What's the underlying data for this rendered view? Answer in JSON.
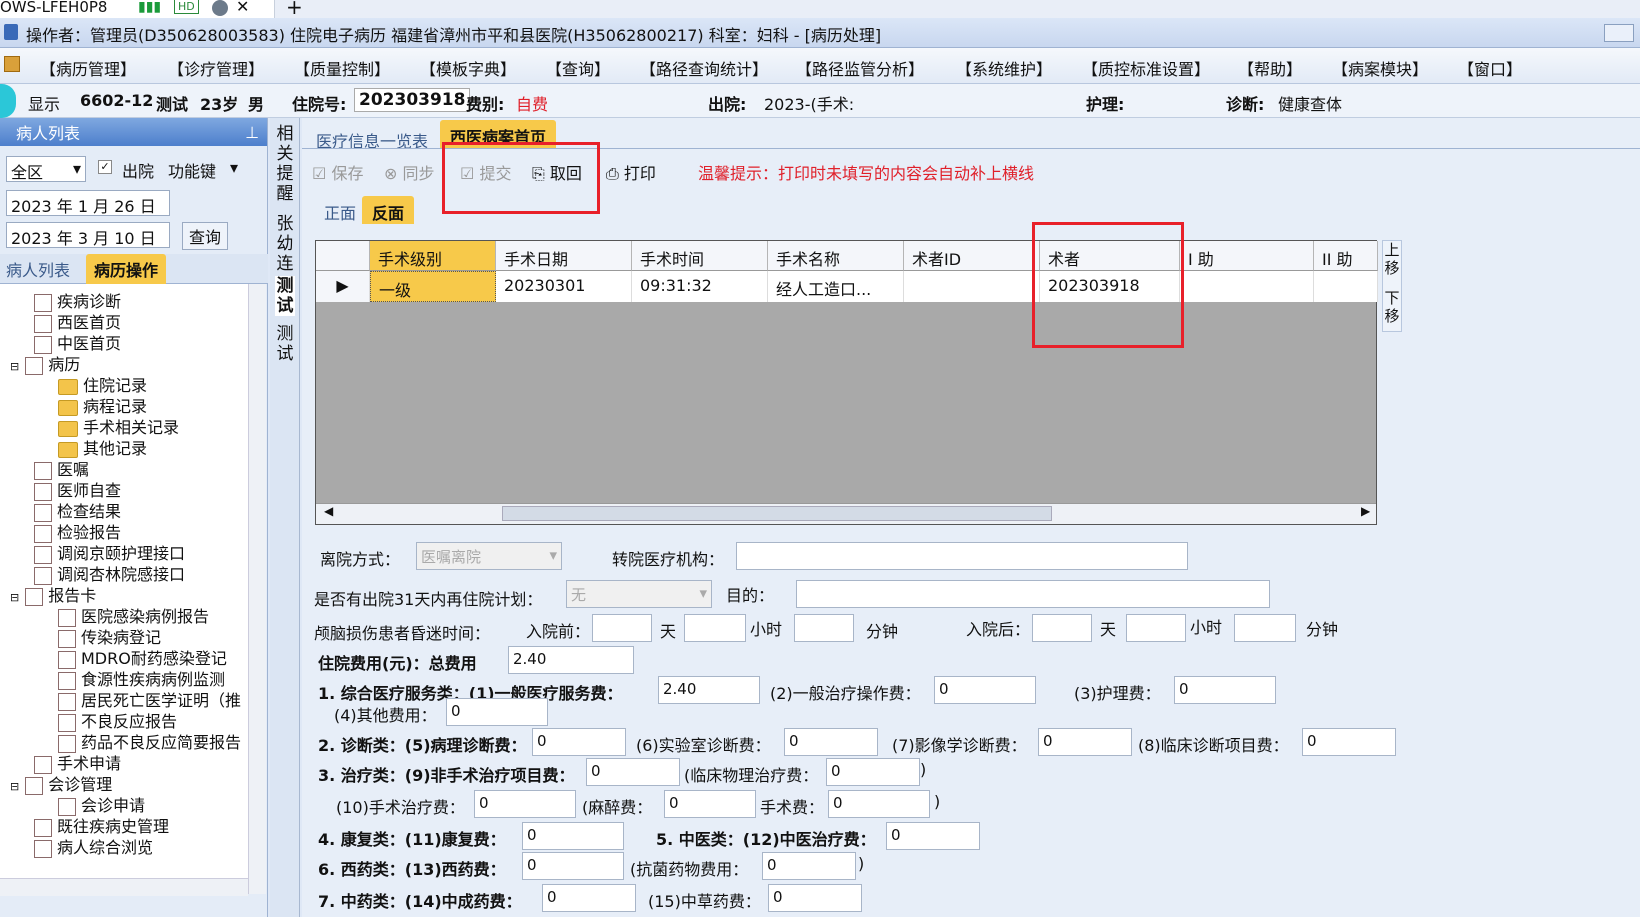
{
  "browser": {
    "tab_title": "OWS-LFEH0P8",
    "hd_badge": "HD",
    "close": "✕",
    "new_tab": "+"
  },
  "titlebar": {
    "text": "操作者：管理员(D350628003583) 住院电子病历  福建省漳州市平和县医院(H35062800217)  科室：妇科 - [病历处理]"
  },
  "menu": [
    "【病历管理】",
    "【诊疗管理】",
    "【质量控制】",
    "【模板字典】",
    "【查询】",
    "【路径查询统计】",
    "【路径监管分析】",
    "【系统维护】",
    "【质控标准设置】",
    "【帮助】",
    "【病案模块】",
    "【窗口】"
  ],
  "info": {
    "display": "显示",
    "bed": "6602-12",
    "name": "测试",
    "age": "23岁",
    "sex": "男",
    "admission_label": "住院号:",
    "admission_no": "202303918",
    "fee_label": "费别:",
    "fee_type": "自费",
    "discharge_label": "出院:",
    "discharge_value": "2023-(手术:",
    "nursing_label": "护理:",
    "diagnosis_label": "诊断:",
    "diagnosis_value": "健康查体"
  },
  "left": {
    "header": "病人列表",
    "pin": "⊥",
    "region": "全区",
    "discharged": "出院",
    "func_keys": "功能键",
    "date_from": "2023 年 1 月 26 日",
    "date_to": "2023 年 3 月 10 日",
    "query": "查询",
    "tab_patients": "病人列表",
    "tab_ops": "病历操作",
    "tree": [
      "疾病诊断",
      "西医首页",
      "中医首页",
      "病历",
      "住院记录",
      "病程记录",
      "手术相关记录",
      "其他记录",
      "医嘱",
      "医师自查",
      "检查结果",
      "检验报告",
      "调阅京颐护理接口",
      "调阅杏林院感接口",
      "报告卡",
      "医院感染病例报告",
      "传染病登记",
      "MDRO耐药感染登记",
      "食源性疾病病例监测",
      "居民死亡医学证明（推",
      "不良反应报告",
      "药品不良反应简要报告",
      "手术申请",
      "会诊管理",
      "会诊申请",
      "既往疾病史管理",
      "病人综合浏览"
    ]
  },
  "vtabs": [
    "相关提醒",
    "张幼连",
    "测试",
    "测试"
  ],
  "main": {
    "tab_list": "医疗信息一览表",
    "tab_home": "西医病案首页",
    "toolbar": {
      "save": "保存",
      "sync": "同步",
      "submit": "提交",
      "retrieve": "取回",
      "print": "打印",
      "tip": "温馨提示：打印时未填写的内容会自动补上横线"
    },
    "subtab_front": "正面",
    "subtab_back": "反面",
    "grid": {
      "headers": [
        "手术级别",
        "手术日期",
        "手术时间",
        "手术名称",
        "术者ID",
        "术者",
        "I 助",
        "II 助"
      ],
      "row": [
        "一级",
        "20230301",
        "09:31:32",
        "经人工造口...",
        "",
        "202303918",
        "",
        ""
      ]
    },
    "move_up": "上移",
    "move_down": "下移",
    "form": {
      "leave_label": "离院方式：",
      "leave_value": "医嘱离院",
      "transfer_label": "转院医疗机构：",
      "readmit_label": "是否有出院31天内再住院计划：",
      "readmit_value": "无",
      "purpose_label": "目的：",
      "coma_label": "颅脑损伤患者昏迷时间：",
      "before_label": "入院前：",
      "after_label": "入院后：",
      "day": "天",
      "hour": "小时",
      "minute": "分钟",
      "cost_label": "住院费用(元)：总费用",
      "cost_total": "2.40",
      "c1": "1. 综合医疗服务类：(1)一般医疗服务费：",
      "c1v": "2.40",
      "c1b": "(2)一般治疗操作费：",
      "c1bv": "0",
      "c1c": "(3)护理费：",
      "c1cv": "0",
      "c1d": "(4)其他费用：",
      "c1dv": "0",
      "c2": "2. 诊断类：(5)病理诊断费：",
      "c2v": "0",
      "c2b": "(6)实验室诊断费：",
      "c2bv": "0",
      "c2c": "(7)影像学诊断费：",
      "c2cv": "0",
      "c2d": "(8)临床诊断项目费：",
      "c2dv": "0",
      "c3": "3. 治疗类：(9)非手术治疗项目费：",
      "c3v": "0",
      "c3b": "(临床物理治疗费：",
      "c3bv": "0",
      "c3c": "(10)手术治疗费：",
      "c3cv": "0",
      "c3d": "(麻醉费：",
      "c3dv": "0",
      "c3e": "手术费：",
      "c3ev": "0",
      "c4": "4. 康复类：(11)康复费：",
      "c4v": "0",
      "c5": "5. 中医类：(12)中医治疗费：",
      "c5v": "0",
      "c6": "6. 西药类：(13)西药费：",
      "c6v": "0",
      "c6b": "(抗菌药物费用：",
      "c6bv": "0",
      "c7": "7. 中药类：(14)中成药费：",
      "c7v": "0",
      "c7b": "(15)中草药费：",
      "c7bv": "0"
    }
  }
}
